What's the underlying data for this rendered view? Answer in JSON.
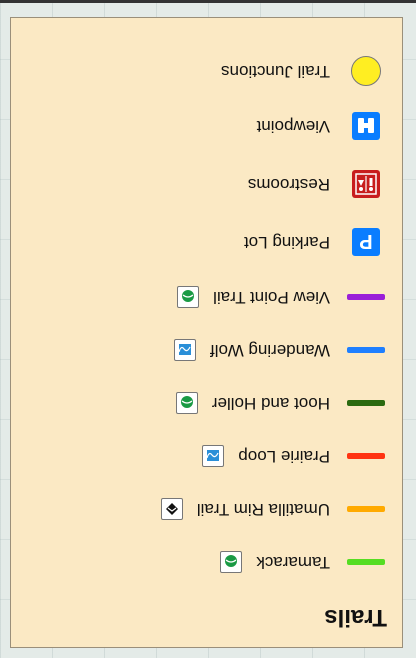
{
  "legend": {
    "title": "Trails",
    "trails": [
      {
        "label": "Tamarack",
        "color": "#55dd22",
        "badge": "easiest-green-circle-icon"
      },
      {
        "label": "Umatilla Rim Trail",
        "color": "#ffaa00",
        "badge": "most-difficult-black-diamond-icon"
      },
      {
        "label": "Prairie Loop",
        "color": "#ff3311",
        "badge": "more-difficult-blue-square-icon"
      },
      {
        "label": "Hoot and Holler",
        "color": "#2b6a10",
        "badge": "easiest-green-circle-icon"
      },
      {
        "label": "Wandering Wolf",
        "color": "#1e7fff",
        "badge": "more-difficult-blue-square-icon"
      },
      {
        "label": "View Point Trail",
        "color": "#9a1fd8",
        "badge": "easiest-green-circle-icon"
      }
    ],
    "poi": [
      {
        "label": "Parking Lot",
        "icon": "parking-icon",
        "color": "#0a7dff"
      },
      {
        "label": "Restrooms",
        "icon": "restrooms-icon",
        "color": "#c81d1d"
      },
      {
        "label": "Viewpoint",
        "icon": "binoculars-icon",
        "color": "#0a7dff"
      },
      {
        "label": "Trail Junctions",
        "icon": "trail-junction-icon",
        "color": "#ffee22"
      }
    ]
  }
}
